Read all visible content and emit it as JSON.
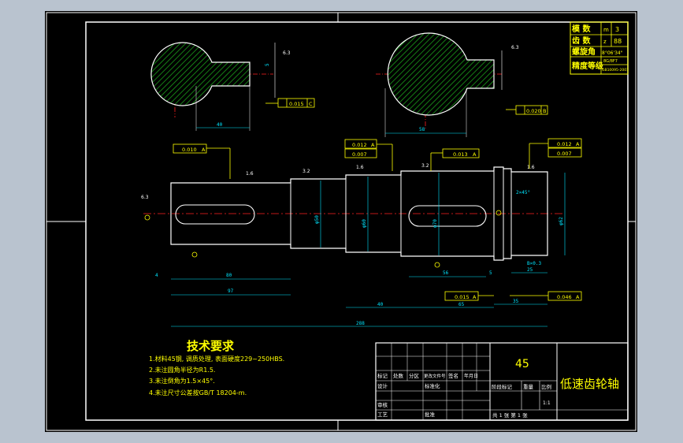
{
  "spec_table": {
    "rows": [
      {
        "label": "模  数",
        "symbol": "m",
        "value": "3"
      },
      {
        "label": "齿  数",
        "symbol": "z",
        "value": "88"
      },
      {
        "label": "螺旋角",
        "symbol": "",
        "value": "8°06'34\""
      },
      {
        "label": "",
        "symbol": "",
        "value": "8G/8F7"
      },
      {
        "label": "精度等级",
        "symbol": "",
        "value": "GB10095-2001"
      }
    ]
  },
  "tolerances": {
    "left_section": "0.015",
    "right_section": "0.020",
    "left_shaft": "0.010",
    "mid_upper": "0.012",
    "mid_upper2": "0.007",
    "mid_right": "0.013",
    "right_upper": "0.012",
    "right_upper2": "0.007",
    "bottom_mid": "0.015",
    "bottom_right": "0.046",
    "datum_a": "A",
    "datum_b": "B",
    "datum_c": "C"
  },
  "dimensions": {
    "sec_left_width": "40",
    "sec_right_width": "58",
    "left_key_len": "80",
    "left_total": "97",
    "dia1": "φ50",
    "dia2": "φ60",
    "dia3": "φ70",
    "dia4": "φ62",
    "chamfer": "2×45°",
    "groove": "B×0.3",
    "mid_key": "56",
    "d40": "40",
    "d65": "65",
    "d25": "25",
    "d35": "35",
    "d4": "4",
    "d5": "5",
    "overall": "288",
    "section_roughness": "6.3"
  },
  "roughness": {
    "r1": "1.6",
    "r2": "3.2",
    "r3": "1.6",
    "r4": "3.2",
    "r5": "1.6",
    "r6": "6.3"
  },
  "tech_requirements": {
    "title": "技术要求",
    "items": [
      "1.材料45钢, 调质处理, 表面硬度229~250HBS.",
      "2.未注圆角半径为R1.5.",
      "3.未注倒角为1.5×45°.",
      "4.未注尺寸公差按GB/T 18204-m."
    ]
  },
  "title_block": {
    "material": "45",
    "part_name": "低速齿轮轴",
    "scale_label": "比例",
    "weight_label": "重量",
    "stage_label": "阶段标记",
    "scale_value": "1:1",
    "sheet": "共 1 张  第 1 张",
    "cells": [
      "标记",
      "处数",
      "分区",
      "更改文件号",
      "签名",
      "年月日",
      "设计",
      "标准化",
      "审核",
      "工艺",
      "批准"
    ]
  },
  "colors": {
    "background": "#000000",
    "line_white": "#ffffff",
    "dim_cyan": "#00e5ff",
    "text_yellow": "#ffff00",
    "center_red": "#ff2020",
    "hatch_green": "#1a9e1a"
  }
}
